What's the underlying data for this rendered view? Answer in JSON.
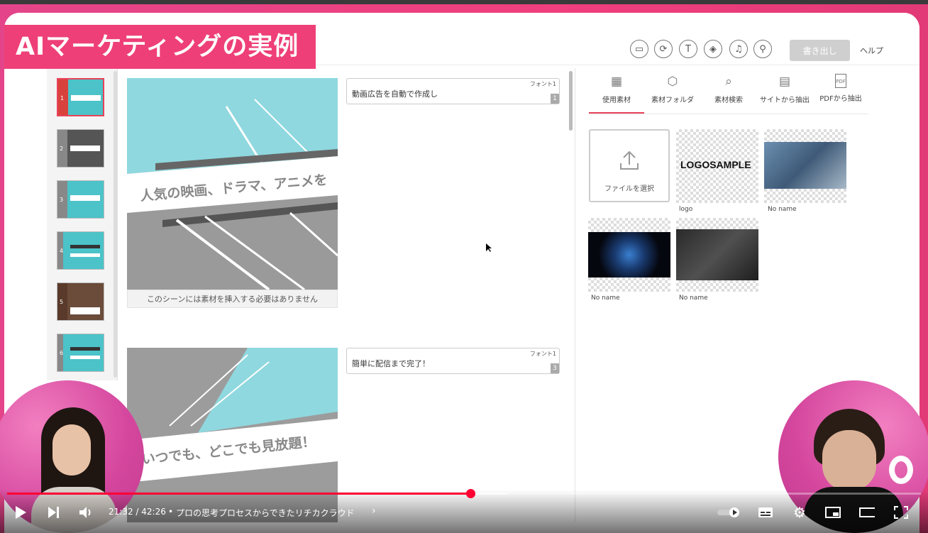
{
  "title_banner": "AIマーケティングの実例",
  "toolbar": {
    "icons": [
      "screen-icon",
      "refresh-icon",
      "text-icon",
      "paint-icon",
      "music-icon",
      "stamp-icon"
    ],
    "export_label": "書き出し",
    "help_label": "ヘルプ"
  },
  "thumbnails": [
    {
      "num": "1",
      "selected": true
    },
    {
      "num": "2",
      "selected": false
    },
    {
      "num": "3",
      "selected": false
    },
    {
      "num": "4",
      "selected": false
    },
    {
      "num": "5",
      "selected": false
    },
    {
      "num": "6",
      "selected": false
    }
  ],
  "scenes": [
    {
      "slide_text": "人気の映画、ドラマ、アニメを",
      "caption": "このシーンには素材を挿入する必要はありません",
      "textbox": {
        "font": "フォント1",
        "text": "動画広告を自動で作成し",
        "index": "1"
      }
    },
    {
      "slide_text": "いつでも、どこでも見放題！",
      "caption": "",
      "textbox": {
        "font": "フォント1",
        "text": "簡単に配信まで完了！",
        "index": "3"
      }
    }
  ],
  "panel": {
    "tabs": [
      {
        "label": "使用素材",
        "icon": "grid-icon",
        "active": true
      },
      {
        "label": "素材フォルダ",
        "icon": "box-icon",
        "active": false
      },
      {
        "label": "素材検索",
        "icon": "search-icon",
        "active": false
      },
      {
        "label": "サイトから抽出",
        "icon": "website-icon",
        "active": false
      },
      {
        "label": "PDFから抽出",
        "icon": "pdf-icon",
        "active": false
      }
    ],
    "pdf_icon_text": "PDF",
    "upload_label": "ファイルを選択",
    "logo_sample_text": "LOGOSAMPLE",
    "media": [
      {
        "label": "logo"
      },
      {
        "label": "No name"
      },
      {
        "label": "No name"
      },
      {
        "label": "No name"
      }
    ]
  },
  "player": {
    "time": "21:32 / 42:26",
    "separator": "•",
    "chapter": "プロの思考プロセスからできたリチカクラウド",
    "progress_fraction": 0.507,
    "buffered_fraction": 0.547
  }
}
